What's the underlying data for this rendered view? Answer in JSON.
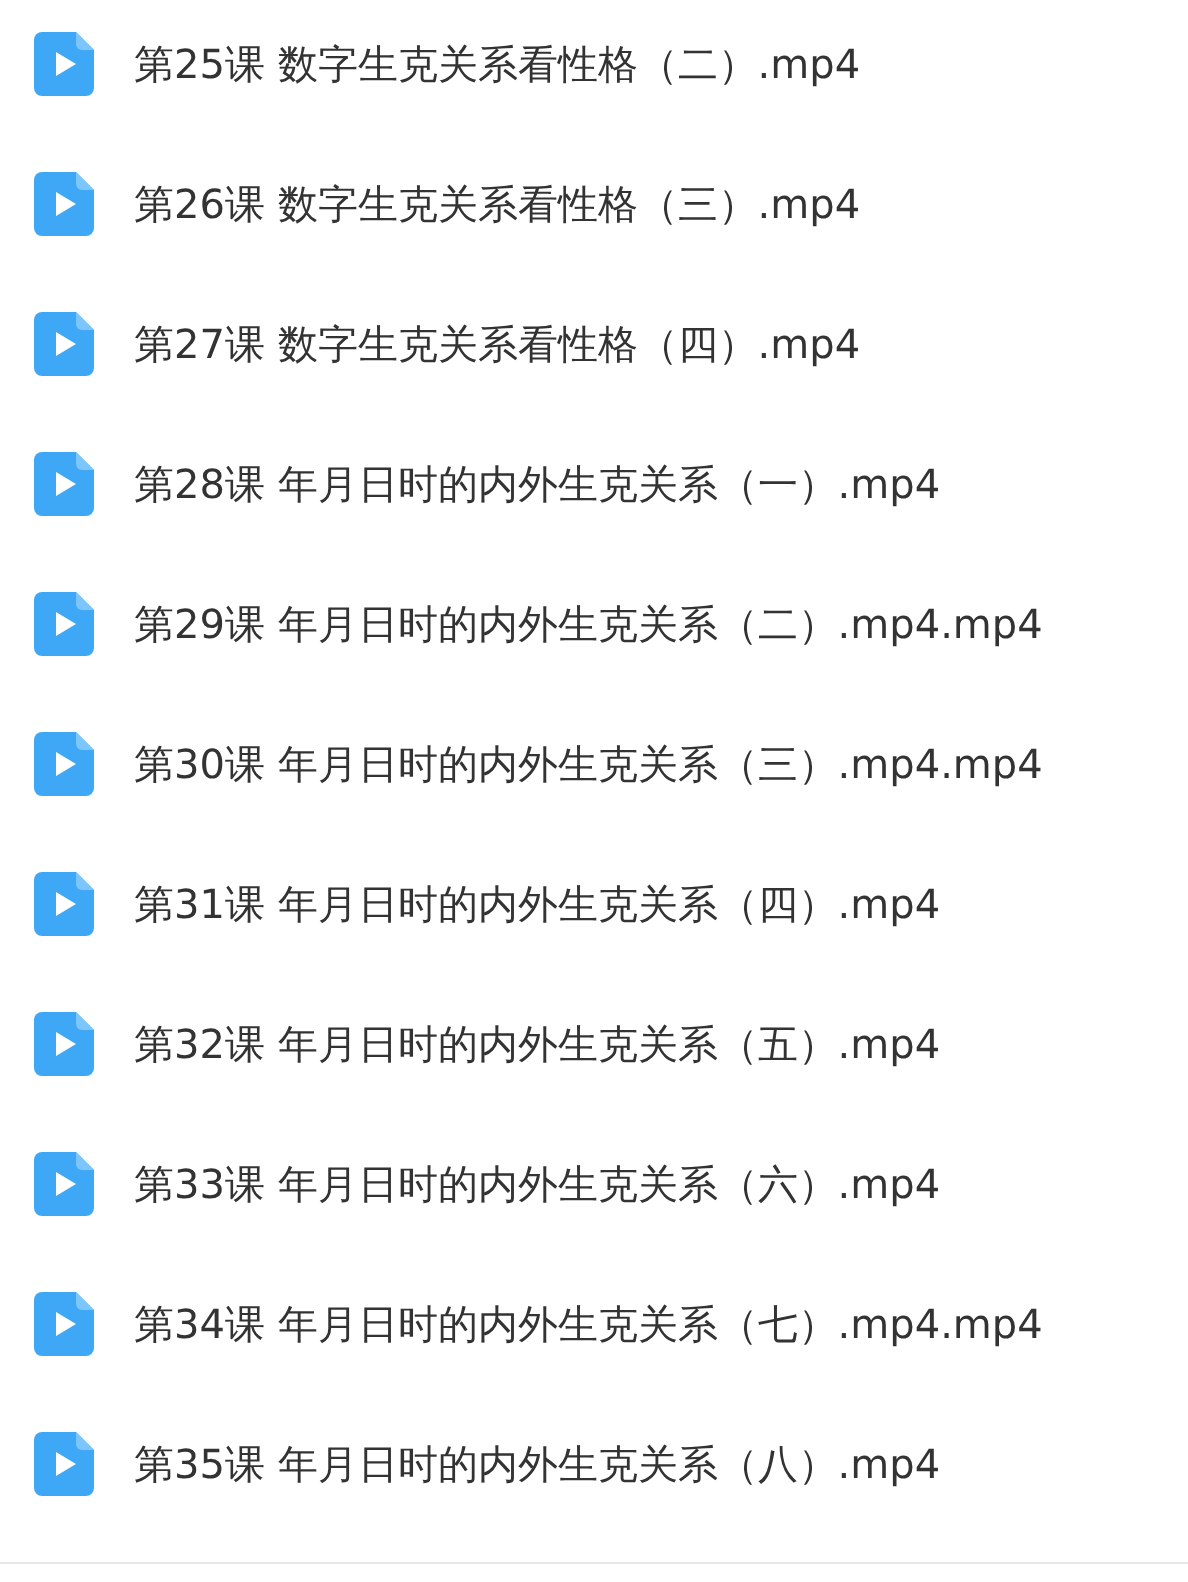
{
  "files": [
    {
      "name": "第25课 数字生克关系看性格（二）.mp4"
    },
    {
      "name": "第26课 数字生克关系看性格（三）.mp4"
    },
    {
      "name": "第27课 数字生克关系看性格（四）.mp4"
    },
    {
      "name": "第28课 年月日时的内外生克关系（一）.mp4"
    },
    {
      "name": "第29课 年月日时的内外生克关系（二）.mp4.mp4"
    },
    {
      "name": "第30课 年月日时的内外生克关系（三）.mp4.mp4"
    },
    {
      "name": "第31课 年月日时的内外生克关系（四）.mp4"
    },
    {
      "name": "第32课 年月日时的内外生克关系（五）.mp4"
    },
    {
      "name": "第33课 年月日时的内外生克关系（六）.mp4"
    },
    {
      "name": "第34课 年月日时的内外生克关系（七）.mp4.mp4"
    },
    {
      "name": "第35课 年月日时的内外生克关系（八）.mp4"
    }
  ]
}
